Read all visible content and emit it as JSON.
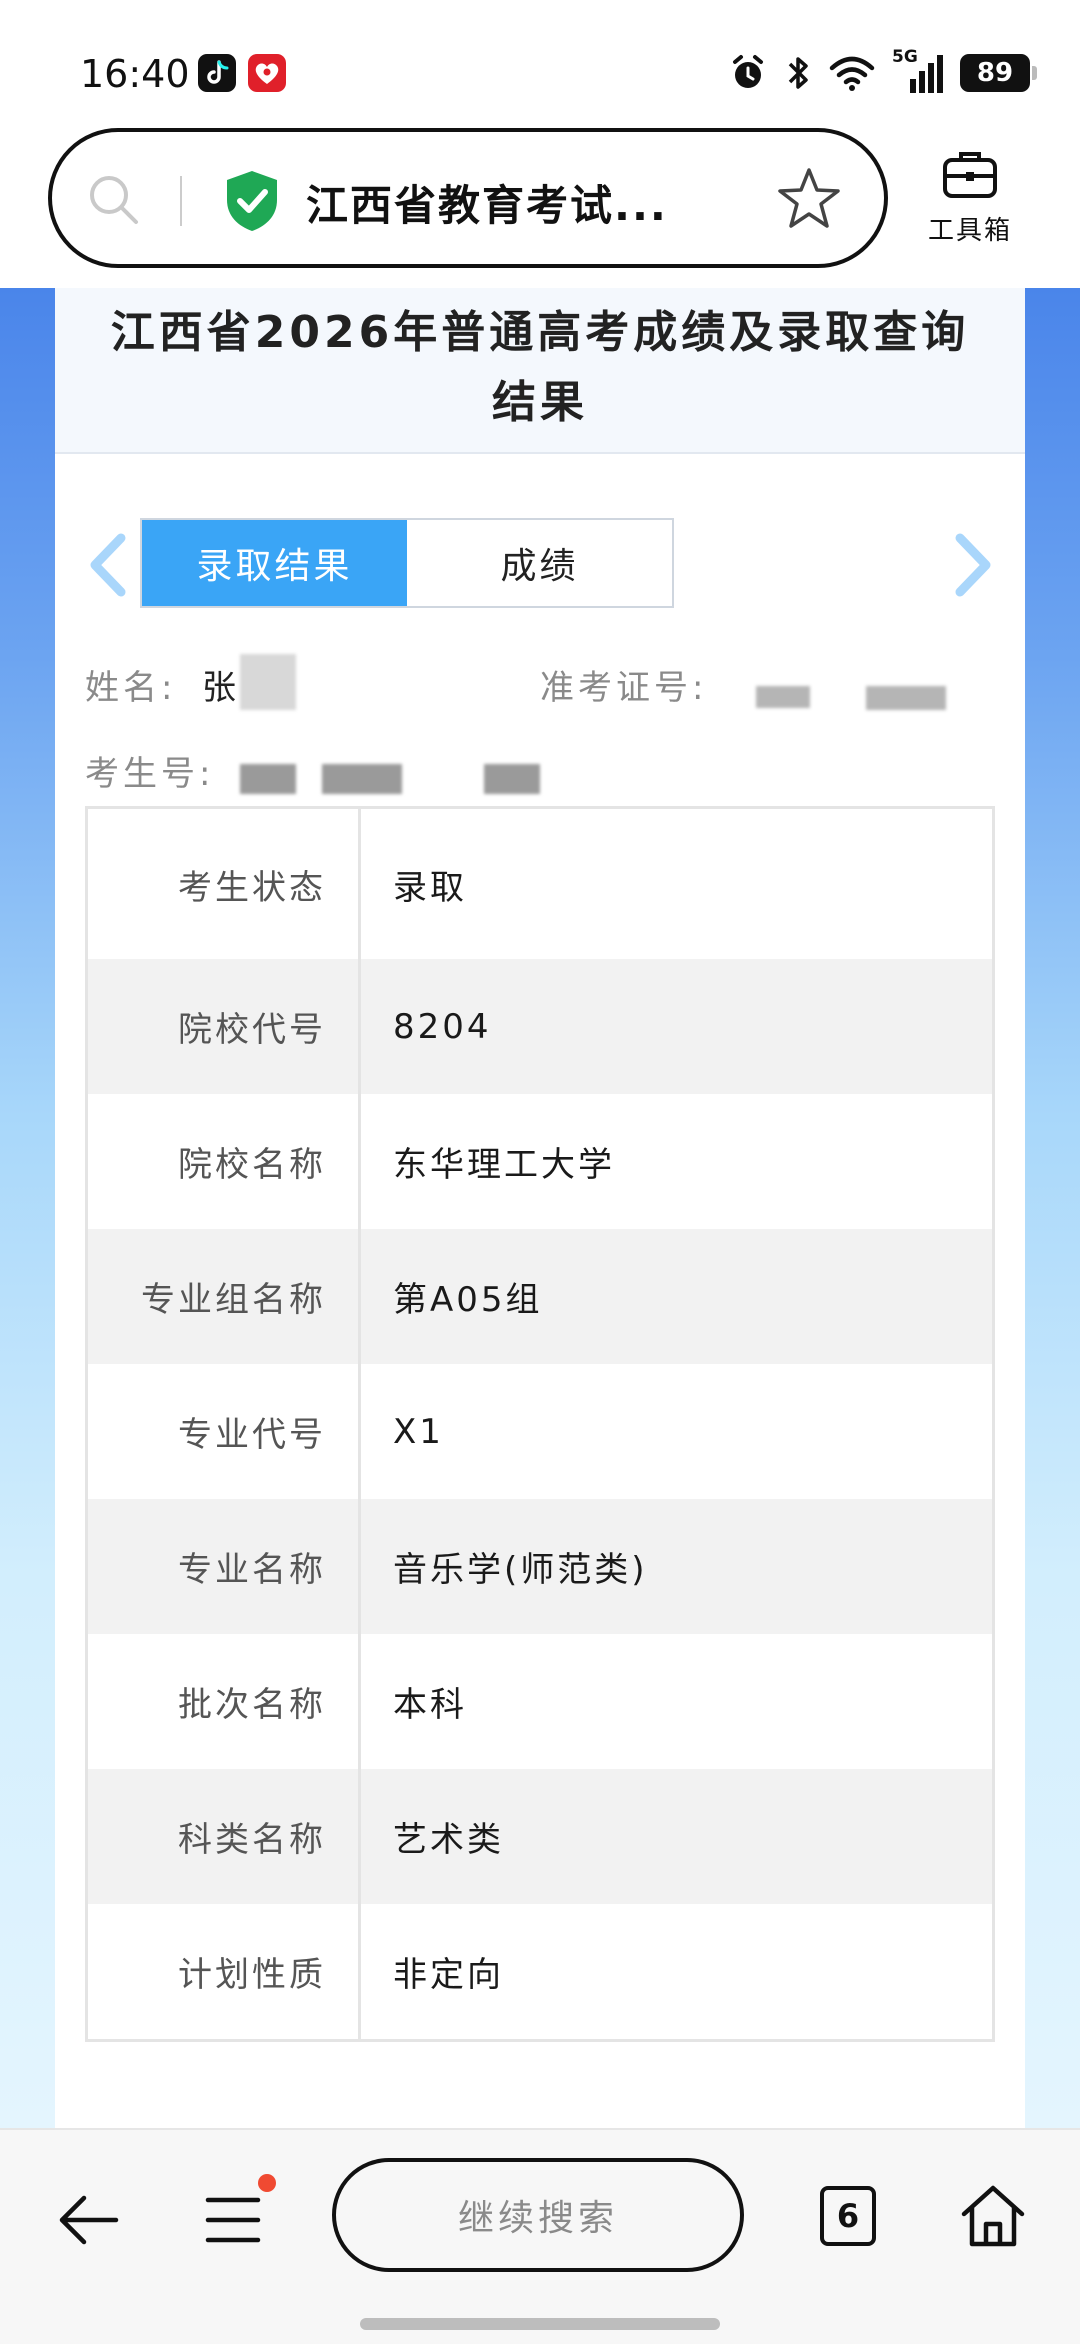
{
  "status_bar": {
    "time": "16:40",
    "network": "5G",
    "battery": "89",
    "icons": [
      "tiktok-icon",
      "pinduoduo-icon",
      "alarm-icon",
      "bluetooth-icon",
      "wifi-icon",
      "signal-icon",
      "battery-icon"
    ]
  },
  "browser": {
    "page_title": "江西省教育考试...",
    "toolbox_label": "工具箱",
    "icons": [
      "search-icon",
      "shield-check-icon",
      "star-icon",
      "toolbox-icon"
    ]
  },
  "page": {
    "title": "江西省2026年普通高考成绩及录取查询结果",
    "tabs": [
      {
        "label": "录取结果",
        "active": true
      },
      {
        "label": "成绩",
        "active": false
      }
    ],
    "info": {
      "name_label": "姓名:",
      "name_value": "张",
      "admission_ticket_label": "准考证号:",
      "candidate_no_label": "考生号:"
    },
    "results": [
      {
        "label": "考生状态",
        "value": "录取"
      },
      {
        "label": "院校代号",
        "value": "8204"
      },
      {
        "label": "院校名称",
        "value": "东华理工大学"
      },
      {
        "label": "专业组名称",
        "value": "第A05组"
      },
      {
        "label": "专业代号",
        "value": "X1"
      },
      {
        "label": "专业名称",
        "value": "音乐学(师范类)"
      },
      {
        "label": "批次名称",
        "value": "本科"
      },
      {
        "label": "科类名称",
        "value": "艺术类"
      },
      {
        "label": "计划性质",
        "value": "非定向"
      }
    ]
  },
  "bottom_nav": {
    "continue_search": "继续搜索",
    "tab_count": "6",
    "icons": [
      "back-arrow-icon",
      "menu-icon",
      "home-icon"
    ]
  },
  "colors": {
    "tab_active": "#3aa5f6",
    "arrow": "#a9d6fb",
    "shield": "#1fa855",
    "notification": "#f04a32"
  }
}
